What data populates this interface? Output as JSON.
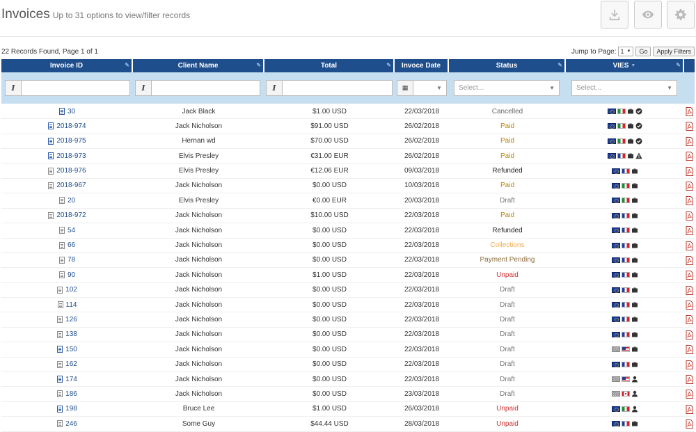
{
  "header": {
    "title": "Invoices",
    "subtitle": "Up to 31 options to view/filter records"
  },
  "meta": {
    "records_text": "22 Records Found, Page 1 of 1",
    "jump_label": "Jump to Page:",
    "page_value": "1",
    "go_label": "Go",
    "apply_label": "Apply Filters"
  },
  "columns": {
    "invoice_id": "Invoice ID",
    "client": "Client Name",
    "total": "Total",
    "date": "Invoce Date",
    "status": "Status",
    "vies": "VIES"
  },
  "filters": {
    "status_placeholder": "Select...",
    "vies_placeholder": "Select..."
  },
  "status_colors": {
    "Cancelled": "#666666",
    "Paid": "#b8860b",
    "Refunded": "#222222",
    "Draft": "#777777",
    "Collections": "#f0ad4e",
    "Payment Pending": "#8a6d3b",
    "Unpaid": "#cc3333"
  },
  "rows": [
    {
      "id": "30",
      "client": "Jack Black",
      "total": "$1.00 USD",
      "date": "22/03/2018",
      "status": "Cancelled",
      "doc": "blue",
      "indent": 1,
      "flags": [
        "eu",
        "it"
      ],
      "icons": [
        "briefcase",
        "check"
      ]
    },
    {
      "id": "2018-974",
      "client": "Jack Nicholson",
      "total": "$91.00 USD",
      "date": "26/02/2018",
      "status": "Paid",
      "doc": "blue",
      "indent": 0,
      "flags": [
        "eu",
        "it"
      ],
      "icons": [
        "briefcase",
        "check"
      ]
    },
    {
      "id": "2018-975",
      "client": "Hernan wd",
      "total": "$70.00 USD",
      "date": "26/02/2018",
      "status": "Paid",
      "doc": "blue",
      "indent": 0,
      "flags": [
        "eu",
        "it"
      ],
      "icons": [
        "briefcase",
        "check"
      ]
    },
    {
      "id": "2018-973",
      "client": "Elvis Presley",
      "total": "€31.00 EUR",
      "date": "26/02/2018",
      "status": "Paid",
      "doc": "blue",
      "indent": 0,
      "flags": [
        "eu",
        "fr"
      ],
      "icons": [
        "briefcase",
        "warning"
      ]
    },
    {
      "id": "2018-976",
      "client": "Elvis Presley",
      "total": "€12.06 EUR",
      "date": "09/03/2018",
      "status": "Refunded",
      "doc": "gray",
      "indent": 0,
      "flags": [
        "eu",
        "fr"
      ],
      "icons": [
        "briefcase"
      ]
    },
    {
      "id": "2018-967",
      "client": "Jack Nicholson",
      "total": "$0.00 USD",
      "date": "10/03/2018",
      "status": "Paid",
      "doc": "gray",
      "indent": 0,
      "flags": [
        "eu",
        "it"
      ],
      "icons": [
        "briefcase"
      ]
    },
    {
      "id": "20",
      "client": "Elvis Presley",
      "total": "€0.00 EUR",
      "date": "20/03/2018",
      "status": "Draft",
      "doc": "gray",
      "indent": 1,
      "flags": [
        "eu",
        "it"
      ],
      "icons": [
        "briefcase"
      ]
    },
    {
      "id": "2018-972",
      "client": "Jack Nicholson",
      "total": "$10.00 USD",
      "date": "22/03/2018",
      "status": "Paid",
      "doc": "gray",
      "indent": 0,
      "flags": [
        "eu",
        "fr"
      ],
      "icons": [
        "briefcase"
      ]
    },
    {
      "id": "54",
      "client": "Jack Nicholson",
      "total": "$0.00 USD",
      "date": "22/03/2018",
      "status": "Refunded",
      "doc": "gray",
      "indent": 1,
      "flags": [
        "eu",
        "fr"
      ],
      "icons": [
        "briefcase"
      ]
    },
    {
      "id": "66",
      "client": "Jack Nicholson",
      "total": "$0.00 USD",
      "date": "22/03/2018",
      "status": "Collections",
      "doc": "gray",
      "indent": 1,
      "flags": [
        "eu",
        "fr"
      ],
      "icons": [
        "briefcase"
      ]
    },
    {
      "id": "78",
      "client": "Jack Nicholson",
      "total": "$0.00 USD",
      "date": "22/03/2018",
      "status": "Payment Pending",
      "doc": "gray",
      "indent": 1,
      "flags": [
        "eu",
        "fr"
      ],
      "icons": [
        "briefcase"
      ]
    },
    {
      "id": "90",
      "client": "Jack Nicholson",
      "total": "$1.00 USD",
      "date": "22/03/2018",
      "status": "Unpaid",
      "doc": "gray",
      "indent": 1,
      "flags": [
        "eu",
        "fr"
      ],
      "icons": [
        "briefcase"
      ]
    },
    {
      "id": "102",
      "client": "Jack Nicholson",
      "total": "$0.00 USD",
      "date": "22/03/2018",
      "status": "Draft",
      "doc": "gray",
      "indent": 1,
      "flags": [
        "eu",
        "fr"
      ],
      "icons": [
        "briefcase"
      ]
    },
    {
      "id": "114",
      "client": "Jack Nicholson",
      "total": "$0.00 USD",
      "date": "22/03/2018",
      "status": "Draft",
      "doc": "gray",
      "indent": 1,
      "flags": [
        "eu",
        "fr"
      ],
      "icons": [
        "briefcase"
      ]
    },
    {
      "id": "126",
      "client": "Jack Nicholson",
      "total": "$0.00 USD",
      "date": "22/03/2018",
      "status": "Draft",
      "doc": "gray",
      "indent": 1,
      "flags": [
        "eu",
        "fr"
      ],
      "icons": [
        "briefcase"
      ]
    },
    {
      "id": "138",
      "client": "Jack Nicholson",
      "total": "$0.00 USD",
      "date": "22/03/2018",
      "status": "Draft",
      "doc": "gray",
      "indent": 1,
      "flags": [
        "eu",
        "fr"
      ],
      "icons": [
        "briefcase"
      ]
    },
    {
      "id": "150",
      "client": "Jack Nicholson",
      "total": "$0.00 USD",
      "date": "22/03/2018",
      "status": "Draft",
      "doc": "blue",
      "indent": 1,
      "flags": [
        "gr",
        "us"
      ],
      "icons": [
        "briefcase"
      ]
    },
    {
      "id": "162",
      "client": "Jack Nicholson",
      "total": "$0.00 USD",
      "date": "22/03/2018",
      "status": "Draft",
      "doc": "gray",
      "indent": 1,
      "flags": [
        "eu",
        "fr"
      ],
      "icons": [
        "briefcase"
      ]
    },
    {
      "id": "174",
      "client": "Jack Nicholson",
      "total": "$0.00 USD",
      "date": "22/03/2018",
      "status": "Draft",
      "doc": "blue",
      "indent": 1,
      "flags": [
        "gr",
        "us"
      ],
      "icons": [
        "user"
      ]
    },
    {
      "id": "186",
      "client": "Jack Nicholson",
      "total": "$0.00 USD",
      "date": "23/03/2018",
      "status": "Draft",
      "doc": "gray",
      "indent": 1,
      "flags": [
        "gr",
        "ca"
      ],
      "icons": [
        "user"
      ]
    },
    {
      "id": "198",
      "client": "Bruce Lee",
      "total": "$1.00 USD",
      "date": "26/03/2018",
      "status": "Unpaid",
      "doc": "blue",
      "indent": 1,
      "flags": [
        "eu",
        "it"
      ],
      "icons": [
        "user"
      ]
    },
    {
      "id": "246",
      "client": "Some Guy",
      "total": "$44.44 USD",
      "date": "28/03/2018",
      "status": "Unpaid",
      "doc": "gray",
      "indent": 1,
      "flags": [
        "eu",
        "fr"
      ],
      "icons": [
        "briefcase"
      ]
    }
  ]
}
